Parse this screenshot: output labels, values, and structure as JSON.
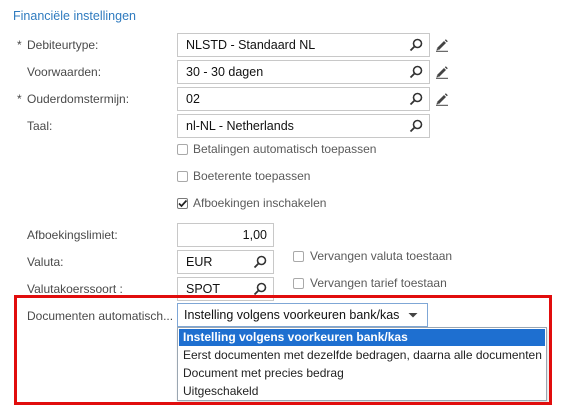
{
  "section": {
    "title": "Financiële instellingen"
  },
  "fields": {
    "customer_type": {
      "label": "Debiteurtype:",
      "required": true,
      "value": "NLSTD - Standaard NL"
    },
    "terms": {
      "label": "Voorwaarden:",
      "required": false,
      "value": "30 - 30 dagen"
    },
    "aging_period": {
      "label": "Ouderdomstermijn:",
      "required": true,
      "value": "02"
    },
    "language": {
      "label": "Taal:",
      "required": false,
      "value": "nl-NL - Netherlands"
    },
    "writeoff_limit": {
      "label": "Afboekingslimiet:",
      "value": "1,00"
    },
    "currency": {
      "label": "Valuta:",
      "value": "EUR"
    },
    "rate_type": {
      "label": "Valutakoerssoort :",
      "value": "SPOT"
    },
    "auto_docs": {
      "label": "Documenten automatisch...",
      "value": "Instelling volgens voorkeuren bank/kas"
    }
  },
  "checkboxes": {
    "auto_payments": {
      "label": "Betalingen automatisch toepassen",
      "checked": false
    },
    "late_interest": {
      "label": "Boeterente toepassen",
      "checked": false
    },
    "enable_writeoffs": {
      "label": "Afboekingen inschakelen",
      "checked": true
    },
    "override_currency": {
      "label": "Vervangen valuta toestaan",
      "checked": false
    },
    "override_rate": {
      "label": "Vervangen tarief toestaan",
      "checked": false
    }
  },
  "dropdown_options": [
    "Instelling volgens voorkeuren bank/kas",
    "Eerst documenten met dezelfde bedragen, daarna alle documenten",
    "Document met precies bedrag",
    "Uitgeschakeld"
  ],
  "selected_option_index": 0,
  "colors": {
    "accent": "#2f7bbf",
    "selection": "#1e6fd0",
    "highlight_border": "#e10d0d"
  }
}
